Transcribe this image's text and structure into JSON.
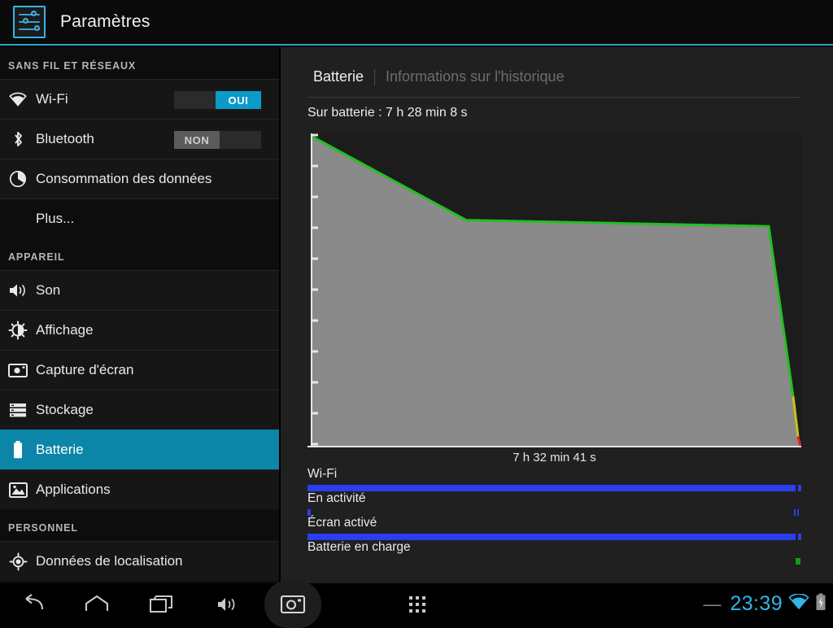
{
  "titlebar": {
    "icon": "settings-sliders-icon",
    "title": "Paramètres"
  },
  "sidebar": {
    "sections": [
      {
        "header": "SANS FIL ET RÉSEAUX",
        "items": [
          {
            "label": "Wi-Fi",
            "icon": "wifi-icon",
            "toggle": "on",
            "toggle_label": "OUI"
          },
          {
            "label": "Bluetooth",
            "icon": "bluetooth-icon",
            "toggle": "off",
            "toggle_label": "NON"
          },
          {
            "label": "Consommation des données",
            "icon": "data-usage-icon"
          },
          {
            "label": "Plus...",
            "icon": "none"
          }
        ]
      },
      {
        "header": "APPAREIL",
        "items": [
          {
            "label": "Son",
            "icon": "sound-icon"
          },
          {
            "label": "Affichage",
            "icon": "brightness-icon"
          },
          {
            "label": "Capture d'écran",
            "icon": "camera-icon"
          },
          {
            "label": "Stockage",
            "icon": "storage-icon"
          },
          {
            "label": "Batterie",
            "icon": "battery-icon",
            "selected": true
          },
          {
            "label": "Applications",
            "icon": "apps-image-icon"
          }
        ]
      },
      {
        "header": "PERSONNEL",
        "items": [
          {
            "label": "Données de localisation",
            "icon": "location-icon"
          }
        ]
      }
    ]
  },
  "content": {
    "breadcrumb_current": "Batterie",
    "breadcrumb_next": "Informations sur l'historique",
    "on_battery_label": "Sur batterie : 7 h 28 min 8 s",
    "chart_xlabel": "7 h 32 min 41 s",
    "history": [
      {
        "label": "Wi-Fi",
        "color": "#2a3ef0",
        "segments": [
          {
            "start": 0.0,
            "end": 0.9885
          },
          {
            "start": 0.9935,
            "end": 1.0
          }
        ]
      },
      {
        "label": "En activité",
        "color": "#2a3ef0",
        "segments": [
          {
            "start": 0.0,
            "end": 0.006
          },
          {
            "start": 0.9855,
            "end": 0.988
          },
          {
            "start": 0.9915,
            "end": 0.994
          }
        ]
      },
      {
        "label": "Écran activé",
        "color": "#2a3ef0",
        "segments": [
          {
            "start": 0.0,
            "end": 0.9885
          },
          {
            "start": 0.9935,
            "end": 1.0
          }
        ]
      },
      {
        "label": "Batterie en charge",
        "color": "#0e9f18",
        "segments": [
          {
            "start": 0.988,
            "end": 0.998
          }
        ]
      }
    ]
  },
  "chart_data": {
    "type": "area",
    "title": "Sur batterie : 7 h 28 min 8 s",
    "xlabel": "7 h 32 min 41 s",
    "ylabel": "",
    "x": [
      0,
      0.315,
      0.935,
      0.975,
      0.985,
      0.995,
      1.0
    ],
    "values": [
      100,
      73,
      71,
      27,
      16,
      3,
      0
    ],
    "xlim": [
      0,
      1
    ],
    "ylim": [
      0,
      100
    ],
    "grid": false,
    "legend": "none",
    "fill_color": "#8a8a8a",
    "plot_background": "#1c1c1c",
    "axis_color": "#e6e6e6",
    "y_tick_count": 10,
    "line_segments": [
      {
        "color": "#22c022",
        "from_index": 0,
        "to_index": 4,
        "name": "green-level"
      },
      {
        "color": "#c8c218",
        "from_index": 4,
        "to_index": 5,
        "name": "yellow-level"
      },
      {
        "color": "#e02020",
        "from_index": 5,
        "to_index": 6,
        "name": "red-level"
      }
    ]
  },
  "navbar": {
    "buttons": [
      {
        "name": "back-icon"
      },
      {
        "name": "home-icon"
      },
      {
        "name": "recents-icon"
      },
      {
        "name": "volume-icon"
      },
      {
        "name": "screenshot-icon"
      },
      {
        "name": "apps-grid-icon"
      }
    ],
    "status": {
      "dash": "—",
      "clock": "23:39",
      "wifi": "wifi-icon",
      "battery": "battery-charging-icon"
    }
  },
  "colors": {
    "accent": "#33b5e5",
    "selected_row": "#0b85a8",
    "toggle_on": "#0b9bc9",
    "battery_green": "#22c022",
    "battery_yellow": "#c8c218",
    "battery_red": "#e02020",
    "history_blue": "#2a3ef0",
    "charge_green": "#0e9f18"
  }
}
